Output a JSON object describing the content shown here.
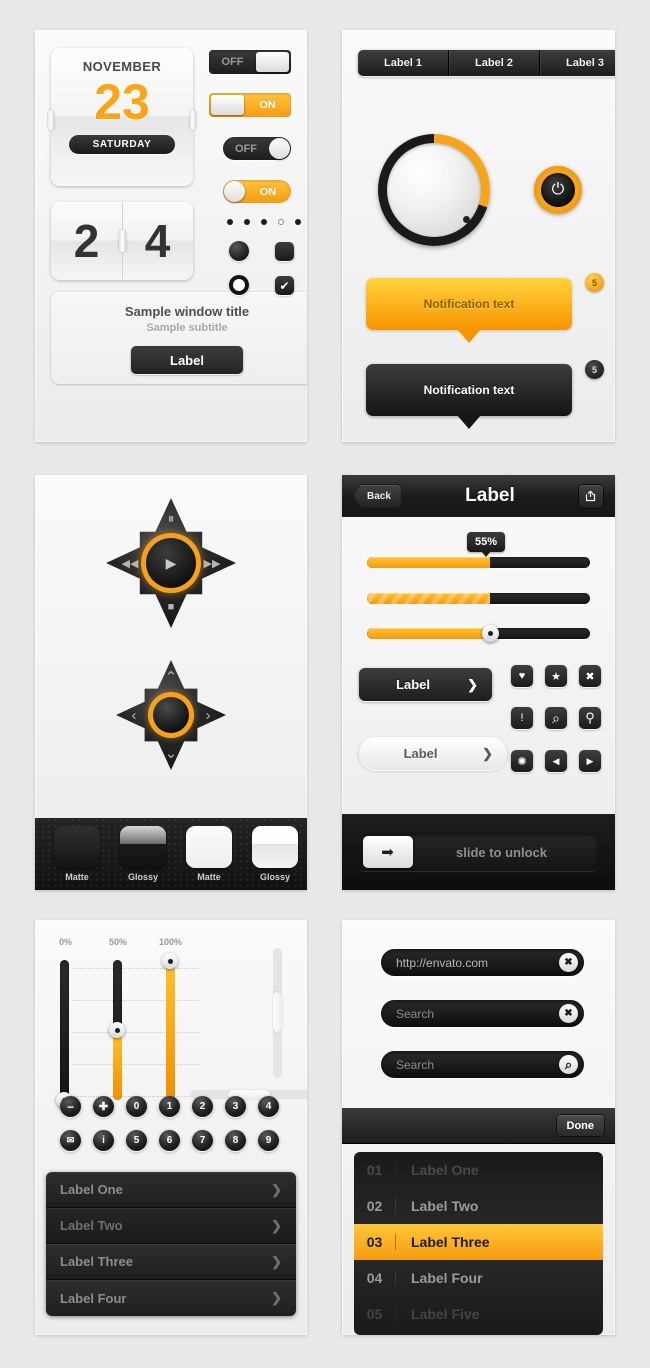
{
  "meta": {
    "accent": "#f7a41d",
    "dark": "#1a1a1a",
    "bg": "#e8e8e8"
  },
  "panel1": {
    "calendar": {
      "month": "NOVEMBER",
      "day": "23",
      "weekday": "SATURDAY"
    },
    "flipclock": {
      "left": "2",
      "right": "4"
    },
    "window": {
      "title": "Sample window title",
      "subtitle": "Sample subtitle",
      "button": "Label"
    },
    "toggles": [
      {
        "label": "OFF",
        "state": "off",
        "shape": "square"
      },
      {
        "label": "ON",
        "state": "on",
        "shape": "square"
      },
      {
        "label": "OFF",
        "state": "off",
        "shape": "rounded"
      },
      {
        "label": "ON",
        "state": "on",
        "shape": "rounded"
      }
    ],
    "dots": [
      "filled",
      "filled",
      "filled",
      "hollow",
      "filled"
    ],
    "selectors": {
      "radio_filled": "radio-filled",
      "checkbox_empty": "checkbox-empty",
      "radio_ring": "radio-ring",
      "checkbox_checked": "checkbox-checked",
      "check_glyph": "✔"
    }
  },
  "panel2": {
    "tabs": [
      "Label 1",
      "Label 2",
      "Label 3"
    ],
    "knob": {
      "value_deg": 108,
      "indicator": "knob-indicator"
    },
    "power": {
      "glyph": "⏻"
    },
    "notifications": [
      {
        "text": "Notification text",
        "style": "yellow",
        "badge": "5"
      },
      {
        "text": "Notification text",
        "style": "dark",
        "badge": "5"
      }
    ]
  },
  "panel3": {
    "media_pad": {
      "up": "⏸",
      "left": "◀◀",
      "right": "▶▶",
      "down": "■",
      "center": "▶"
    },
    "nav_pad": {
      "up": "⌃",
      "left": "‹",
      "right": "›",
      "down": "⌄",
      "center": ""
    },
    "swatches": [
      {
        "label": "Matte",
        "tone": "dark"
      },
      {
        "label": "Glossy",
        "tone": "dark"
      },
      {
        "label": "Matte",
        "tone": "light"
      },
      {
        "label": "Glossy",
        "tone": "light"
      }
    ]
  },
  "panel4": {
    "header": {
      "back": "Back",
      "title": "Label",
      "share_icon": "share-icon"
    },
    "progress": [
      {
        "percent": 55,
        "label": "55%",
        "style": "solid",
        "tooltip": true
      },
      {
        "percent": 55,
        "label": "",
        "style": "striped",
        "tooltip": false
      },
      {
        "percent": 55,
        "label": "",
        "style": "handle",
        "tooltip": false
      }
    ],
    "buttons": [
      {
        "label": "Label",
        "style": "dark",
        "arrow": "❯"
      },
      {
        "label": "Label",
        "style": "light",
        "arrow": "❯"
      }
    ],
    "icons": [
      {
        "name": "heart-icon",
        "glyph": "♥"
      },
      {
        "name": "star-icon",
        "glyph": "★"
      },
      {
        "name": "close-icon",
        "glyph": "✖"
      },
      {
        "name": "alert-icon",
        "glyph": "!"
      },
      {
        "name": "search-icon",
        "glyph": "⌕"
      },
      {
        "name": "location-icon",
        "glyph": "⚲"
      },
      {
        "name": "gear-icon",
        "glyph": "✺"
      },
      {
        "name": "arrow-left-icon",
        "glyph": "◀"
      },
      {
        "name": "arrow-right-icon",
        "glyph": "▶"
      }
    ],
    "unlock": {
      "text": "slide to unlock",
      "knob_icon": "arrow-right-icon",
      "knob_glyph": "➡"
    }
  },
  "panel5": {
    "scale_labels": [
      "0%",
      "50%",
      "100%"
    ],
    "sliders": [
      {
        "name": "slider-0",
        "value": 0
      },
      {
        "name": "slider-50",
        "value": 50
      },
      {
        "name": "slider-100",
        "value": 100
      }
    ],
    "scrollbars": {
      "vertical": "scrollbar-vertical",
      "horizontal": "scrollbar-horizontal"
    },
    "round_buttons_row1": [
      "−",
      "✚",
      "0",
      "1",
      "2",
      "3",
      "4"
    ],
    "round_buttons_row2": [
      "✉",
      "i",
      "5",
      "6",
      "7",
      "8",
      "9"
    ],
    "list": [
      {
        "label": "Label One",
        "arrow": "❯"
      },
      {
        "label": "Label Two",
        "arrow": "❯"
      },
      {
        "label": "Label Three",
        "arrow": "❯"
      },
      {
        "label": "Label Four",
        "arrow": "❯"
      }
    ]
  },
  "panel6": {
    "fields": [
      {
        "name": "url-field",
        "value": "http://envato.com",
        "action": "clear-icon",
        "glyph": "✖"
      },
      {
        "name": "search-field-1",
        "value": "Search",
        "action": "clear-icon",
        "glyph": "✖"
      },
      {
        "name": "search-field-2",
        "value": "Search",
        "action": "search-icon",
        "glyph": "⌕"
      }
    ],
    "toolbar": {
      "done": "Done"
    },
    "picker": [
      {
        "num": "01",
        "label": "Label One",
        "selected": false,
        "fade": "f1"
      },
      {
        "num": "02",
        "label": "Label Two",
        "selected": false,
        "fade": ""
      },
      {
        "num": "03",
        "label": "Label Three",
        "selected": true,
        "fade": ""
      },
      {
        "num": "04",
        "label": "Label Four",
        "selected": false,
        "fade": ""
      },
      {
        "num": "05",
        "label": "Label Five",
        "selected": false,
        "fade": "f2"
      }
    ]
  }
}
